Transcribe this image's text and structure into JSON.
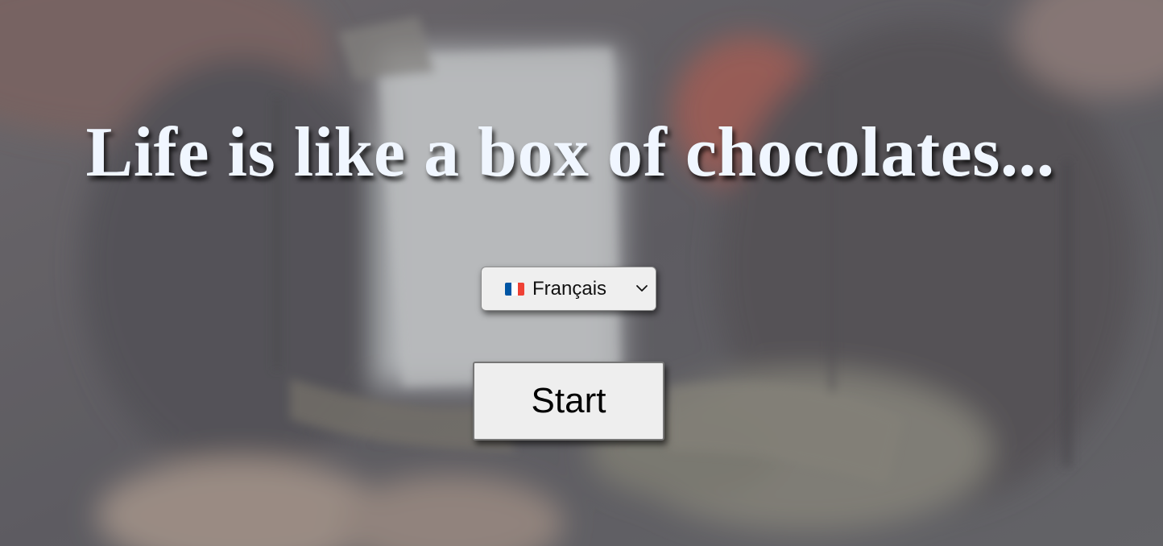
{
  "hero": {
    "title": "Life is like a box of chocolates..."
  },
  "language_select": {
    "flag_icon": "france-flag-icon",
    "selected": "Français",
    "chevron_icon": "chevron-down-icon"
  },
  "start_button": {
    "label": "Start"
  },
  "colors": {
    "title_text": "#f0f6ff",
    "control_background": "#efefef",
    "flag_blue": "#0055a4",
    "flag_white": "#ffffff",
    "flag_red": "#ef4135"
  }
}
